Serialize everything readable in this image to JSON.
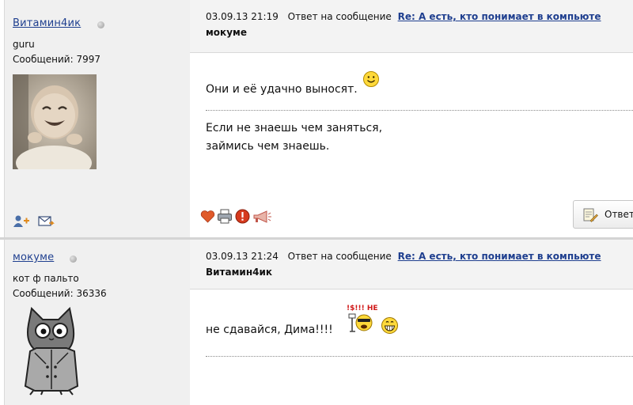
{
  "posts": [
    {
      "author": {
        "name": "Витамин4ик",
        "rank": "guru",
        "posts_count": "Сообщений: 7997",
        "avatar": "baby-photo"
      },
      "datetime": "03.09.13 21:19",
      "reply_prefix": "Ответ на сообщение",
      "reply_title": "Re: А есть, кто понимает в компьюте",
      "recipient": "мокуме",
      "body": "Они и её удачно выносят.",
      "signature_lines": [
        "Если не знаешь чем заняться,",
        "займись чем знаешь."
      ],
      "author_icons": [
        "add-friend-icon",
        "send-message-icon"
      ],
      "action_icons": [
        "heart-icon",
        "print-icon",
        "warning-icon",
        "megaphone-icon"
      ],
      "reply_button_label": "Ответ"
    },
    {
      "author": {
        "name": "мокуме",
        "rank": "кот ф пальто",
        "posts_count": "Сообщений: 36336",
        "avatar": "cat-in-coat-drawing"
      },
      "datetime": "03.09.13 21:24",
      "reply_prefix": "Ответ на сообщение",
      "reply_title": "Re: А есть, кто понимает в компьюте",
      "recipient": "Витамин4ик",
      "body": "не сдавайся, Дима!!!!",
      "emoticon_caption": "!$!!! НЕ"
    }
  ],
  "colors": {
    "link": "#1f3f8f",
    "author_bg": "#f0f0f0",
    "header_bg": "#f3f3f3"
  }
}
